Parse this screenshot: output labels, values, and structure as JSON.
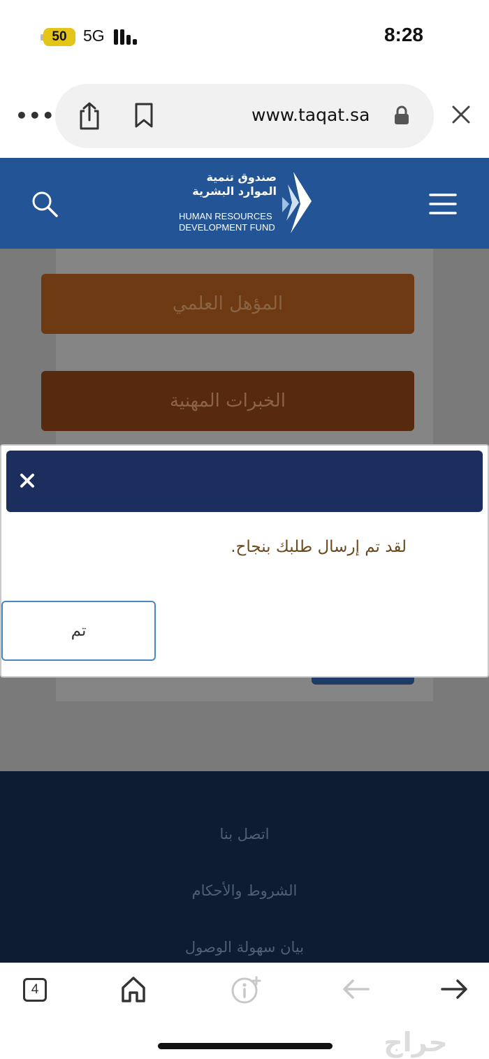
{
  "status_bar": {
    "battery": "50",
    "network": "5G",
    "time": "8:28"
  },
  "browser": {
    "url": "www.taqat.sa",
    "more_icon": "ellipsis-icon",
    "share_icon": "share-icon",
    "bookmark_icon": "bookmark-icon",
    "lock_icon": "lock-icon",
    "close_icon": "close-icon"
  },
  "header": {
    "logo_ar_line1": "صندوق تنمية",
    "logo_ar_line2": "الموارد البشرية",
    "logo_en_line1": "HUMAN RESOURCES",
    "logo_en_line2": "DEVELOPMENT FUND",
    "bg_color": "#235495"
  },
  "form": {
    "qualification_button": "المؤهل العلمي",
    "experience_button": "الخبرات المهنية"
  },
  "modal": {
    "message": "لقد تم إرسال طلبك بنجاح.",
    "ok_button": "تم",
    "header_color": "#1c2e5e"
  },
  "footer": {
    "links": [
      "اتصل بنا",
      "الشروط والأحكام",
      "بيان سهولة الوصول"
    ]
  },
  "toolbar": {
    "tabs_count": "4"
  },
  "watermark": "حراج"
}
